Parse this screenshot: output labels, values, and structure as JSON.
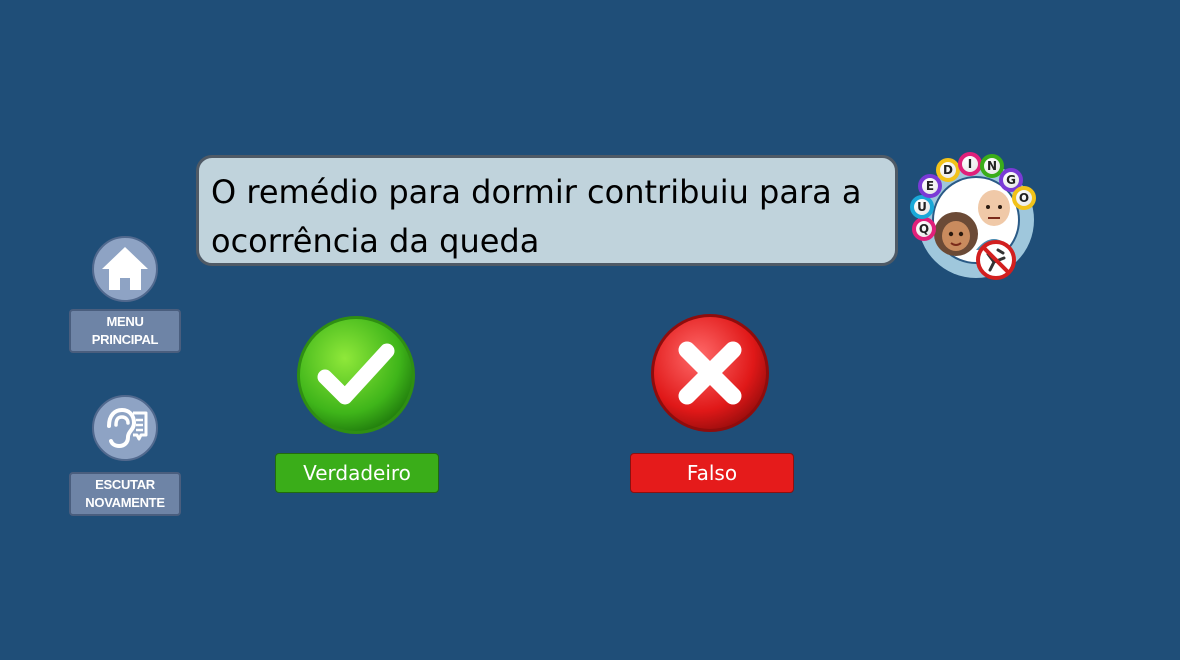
{
  "sidebar": {
    "menu": {
      "label_line1": "MENU",
      "label_line2": "PRINCIPAL",
      "icon": "home-icon"
    },
    "listen": {
      "label_line1": "ESCUTAR",
      "label_line2": "NOVAMENTE",
      "icon": "ear-icon"
    }
  },
  "question": {
    "text": "O remédio para dormir contribuiu para a ocorrência da queda"
  },
  "answers": {
    "true": {
      "label": "Verdadeiro",
      "icon": "check-icon",
      "color": "#3aad19"
    },
    "false": {
      "label": "Falso",
      "icon": "x-icon",
      "color": "#e51b1b"
    }
  },
  "logo": {
    "letters": [
      "Q",
      "U",
      "E",
      "D",
      "I",
      "N",
      "G",
      "O"
    ]
  },
  "colors": {
    "background": "#1f4e78",
    "question_box": "#c0d3dc",
    "side_button": "#6e84a6"
  }
}
